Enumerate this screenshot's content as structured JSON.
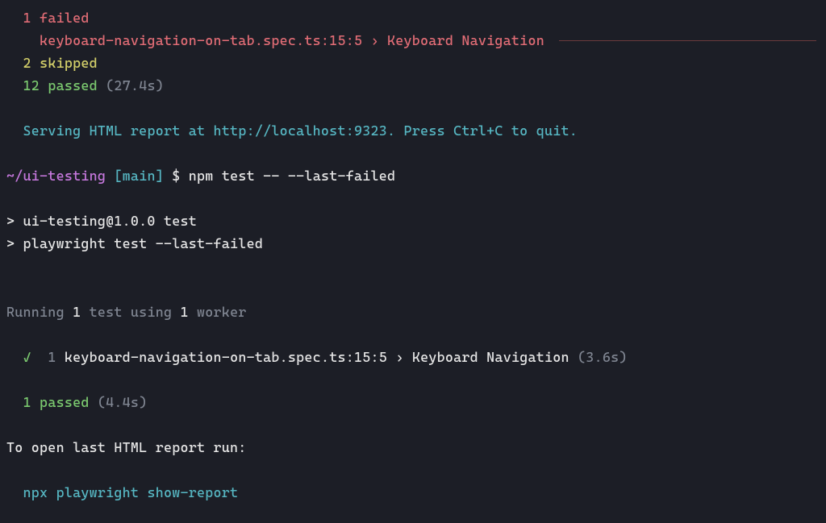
{
  "summary1": {
    "failed_count": "1",
    "failed_label": "failed",
    "failed_test_indent": "    ",
    "failed_test": "keyboard-navigation-on-tab.spec.ts:15:5 › Keyboard Navigation ",
    "skipped_count": "2",
    "skipped_label": "skipped",
    "passed_count": "12",
    "passed_label": "passed",
    "passed_time": "(27.4s)"
  },
  "serve_msg": "Serving HTML report at http://localhost:9323. Press Ctrl+C to quit.",
  "prompt": {
    "path": "~/ui-testing",
    "branch_open": " [",
    "branch": "main",
    "branch_close": "] ",
    "symbol": "$ ",
    "command": "npm test -- --last-failed"
  },
  "npm_out1": "> ui-testing@1.0.0 test",
  "npm_out2": "> playwright test --last-failed",
  "running": {
    "prefix": "Running ",
    "count1": "1",
    "mid": " test using ",
    "count2": "1",
    "suffix": " worker"
  },
  "test_result": {
    "indent": "  ",
    "check": "✓",
    "gap": "  ",
    "num": "1",
    "gap2": " ",
    "name": "keyboard-navigation-on-tab.spec.ts:15:5 › Keyboard Navigation",
    "time": " (3.6s)"
  },
  "summary2": {
    "indent": "  ",
    "passed_count": "1",
    "passed_label": " passed",
    "passed_time": " (4.4s)"
  },
  "open_report_msg": "To open last HTML report run:",
  "open_report_cmd_indent": "  ",
  "open_report_cmd": "npx playwright show-report"
}
